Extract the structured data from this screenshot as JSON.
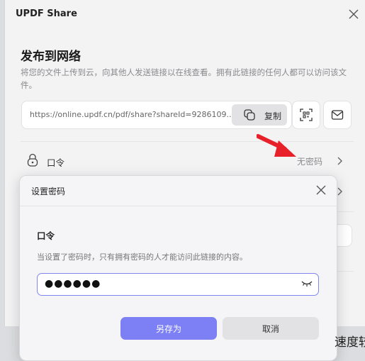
{
  "window": {
    "title": "UPDF Share"
  },
  "share": {
    "heading": "发布到网络",
    "description": "将您的文件上传到云，向其他人发送链接以在线查看。拥有此链接的任何人都可以访问该文件。",
    "url": "https://online.updf.cn/pdf/share?shareId=9286109...",
    "copy_label": "复制",
    "qr_icon": "qr-code-icon",
    "mail_icon": "mail-icon"
  },
  "password_row": {
    "label": "口令",
    "value": "无密码",
    "icon": "lock-icon"
  },
  "dialog": {
    "title": "设置密码",
    "field_label": "口令",
    "hint": "当设置了密码时，只有拥有密码的人才能访问此链接的内容。",
    "password_value": "●●●●●●",
    "save_label": "另存为",
    "cancel_label": "取消"
  },
  "background_text": "速度较",
  "colors": {
    "accent": "#7d80f4",
    "focus_border": "#7f86f2",
    "arrow": "#e8202a"
  }
}
